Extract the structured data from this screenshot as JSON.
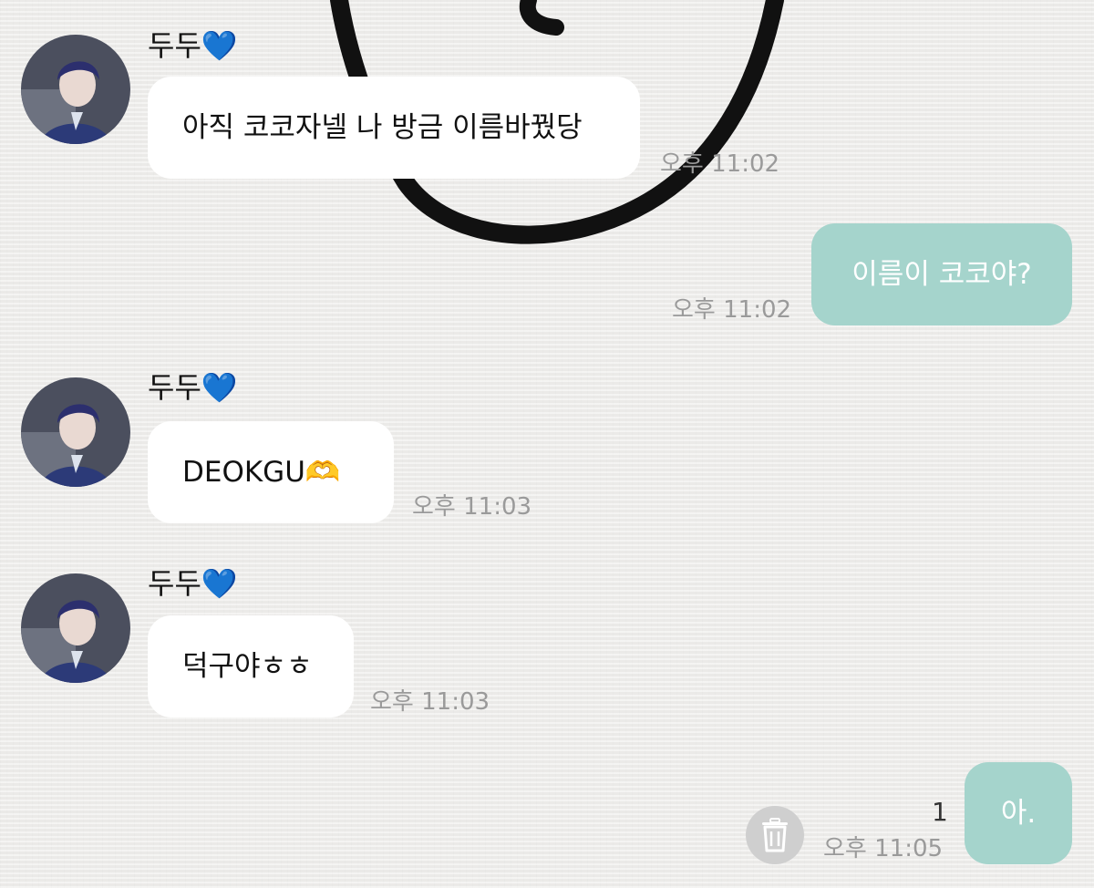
{
  "contact": {
    "name": "두두",
    "heart": "💙"
  },
  "messages": [
    {
      "side": "in",
      "text": "아직 코코자넬 나 방금 이름바꿨당",
      "time": "오후 11:02"
    },
    {
      "side": "out",
      "text": "이름이 코코야?",
      "time": "오후 11:02"
    },
    {
      "side": "in",
      "text": "DEOKGU🫶",
      "time": "오후 11:03"
    },
    {
      "side": "in",
      "text": "덕구야ㅎㅎ",
      "time": "오후 11:03"
    },
    {
      "side": "out",
      "text": "아.",
      "time": "오후 11:05",
      "unread": "1"
    }
  ],
  "colors": {
    "incoming_bubble": "#ffffff",
    "outgoing_bubble": "#a5d4cc",
    "timestamp": "#9a9a9a"
  },
  "icons": {
    "delete": "trash-icon"
  }
}
